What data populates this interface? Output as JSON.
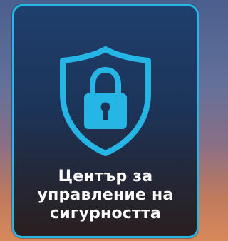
{
  "tile": {
    "label_lines": [
      "Център за",
      "управление на",
      "сигурността"
    ],
    "icon": "shield-lock-icon",
    "accent_color": "#25b6e6"
  }
}
